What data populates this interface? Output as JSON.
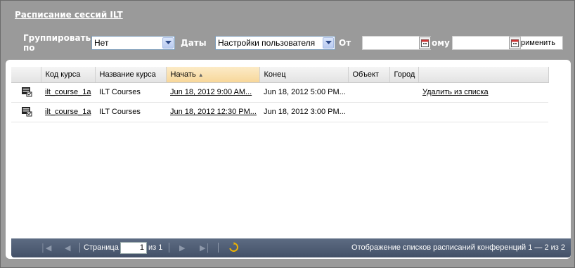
{
  "title": "Расписание сессий ILT",
  "filters": {
    "group_label": "Группировать по",
    "group_value": "Нет",
    "dates_label": "Даты",
    "dates_value": "Настройки пользователя",
    "from_label": "От",
    "to_label": "ому",
    "from_value": "",
    "to_value": "",
    "apply_label": "рименить"
  },
  "grid": {
    "columns": [
      "Код курса",
      "Название курса",
      "Начать",
      "Конец",
      "Объект",
      "Город"
    ],
    "sorted_column_index": 2,
    "sort_direction": "asc",
    "rows": [
      {
        "code": "ilt_course_1a",
        "name": "ILT Courses",
        "start": "Jun 18, 2012 9:00 AM...",
        "end": "Jun 18, 2012 5:00 PM...",
        "facility": "",
        "city": "",
        "action": "Удалить из списка"
      },
      {
        "code": "ilt_course_1a",
        "name": "ILT Courses",
        "start": "Jun 18, 2012 12:30 PM...",
        "end": "Jun 18, 2012 3:00 PM...",
        "facility": "",
        "city": "",
        "action": ""
      }
    ]
  },
  "pager": {
    "page_label": "Страница",
    "page_value": "1",
    "of_label": "из 1",
    "status": "Отображение списков расписаний конференций 1 — 2 из 2"
  },
  "icons": {
    "first": "first-page-icon",
    "prev": "prev-page-icon",
    "next": "next-page-icon",
    "last": "last-page-icon",
    "refresh": "refresh-icon",
    "row": "session-icon"
  }
}
